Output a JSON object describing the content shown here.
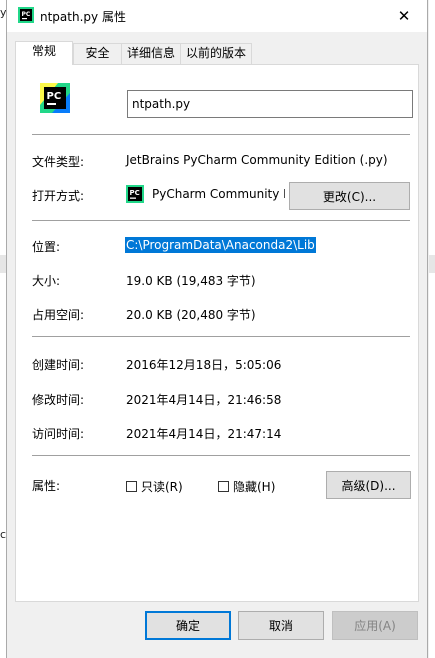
{
  "window": {
    "title": "ntpath.py 属性",
    "close_glyph": "✕"
  },
  "tabs": [
    {
      "label": "常规"
    },
    {
      "label": "安全"
    },
    {
      "label": "详细信息"
    },
    {
      "label": "以前的版本"
    }
  ],
  "general": {
    "icon_text": "PC",
    "file_name": "ntpath.py",
    "file_type": {
      "label": "文件类型:",
      "value": "JetBrains PyCharm Community Edition (.py)"
    },
    "open_with": {
      "label": "打开方式:",
      "value": "PyCharm Community E",
      "button": "更改(C)..."
    },
    "location": {
      "label": "位置:",
      "value": "C:\\ProgramData\\Anaconda2\\Lib"
    },
    "size": {
      "label": "大小:",
      "value": "19.0 KB (19,483 字节)"
    },
    "size_on_disk": {
      "label": "占用空间:",
      "value": "20.0 KB (20,480 字节)"
    },
    "created": {
      "label": "创建时间:",
      "value": "2016年12月18日，5:05:06"
    },
    "modified": {
      "label": "修改时间:",
      "value": "2021年4月14日，21:46:58"
    },
    "accessed": {
      "label": "访问时间:",
      "value": "2021年4月14日，21:47:14"
    },
    "attributes": {
      "label": "属性:",
      "readonly": "只读(R)",
      "hidden": "隐藏(H)",
      "advanced": "高级(D)..."
    }
  },
  "buttons": {
    "ok": "确定",
    "cancel": "取消",
    "apply": "应用(A)"
  },
  "background": {
    "left_fragments": [
      "y",
      "c"
    ]
  },
  "colors": {
    "selection": "#0078d7",
    "pycharm_green": "#21d789",
    "pycharm_blue": "#087cfa"
  }
}
